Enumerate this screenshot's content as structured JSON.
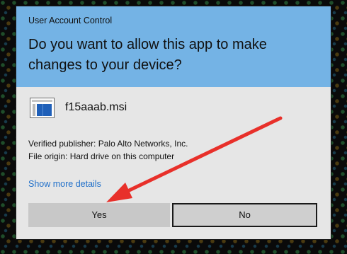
{
  "dialog": {
    "caption": "User Account Control",
    "question": "Do you want to allow this app to make changes to your device?",
    "app": {
      "icon": "msi-installer-icon",
      "name": "f15aaab.msi"
    },
    "publisher_line": "Verified publisher: Palo Alto Networks, Inc.",
    "origin_line": "File origin: Hard drive on this computer",
    "more_details_link": "Show more details",
    "buttons": {
      "yes": "Yes",
      "no": "No"
    }
  },
  "annotation": {
    "type": "arrow",
    "color": "#e8302a",
    "points_to": "yes-button"
  },
  "colors": {
    "header": "#74b3e5",
    "body": "#e6e6e6",
    "link": "#1f6fc9"
  }
}
